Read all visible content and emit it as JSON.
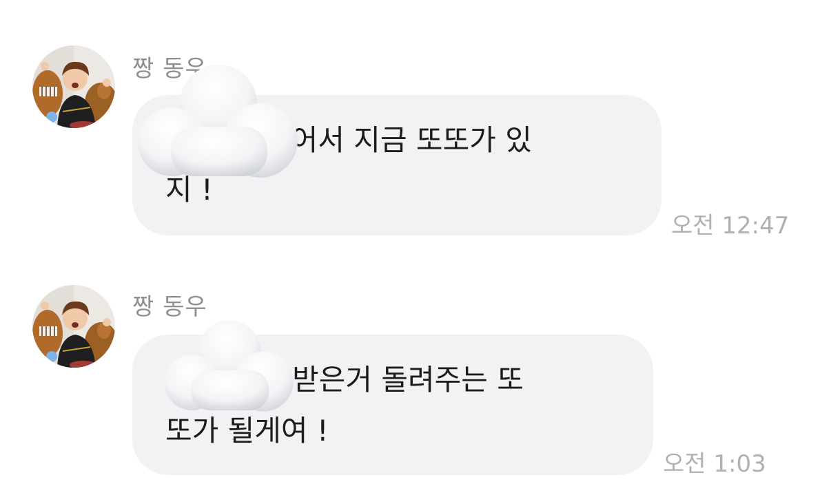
{
  "messages": [
    {
      "sender": "짱 동우",
      "line1": "    다가 있어서 지금 또또가 있",
      "line2": "지 !",
      "time": "오전 12:47",
      "redaction": "cloud-emoji"
    },
    {
      "sender": "짱 동우",
      "line1": "       한테 받은거 돌려주는 또",
      "line2": "또가 될게여 !",
      "time": "오전 1:03",
      "redaction": "cloud-emoji"
    }
  ],
  "colors": {
    "bubble": "#f2f2f4",
    "message_text": "#1c1c1e",
    "sender_text": "#8e8e93",
    "time_text": "#b0b0b5"
  }
}
